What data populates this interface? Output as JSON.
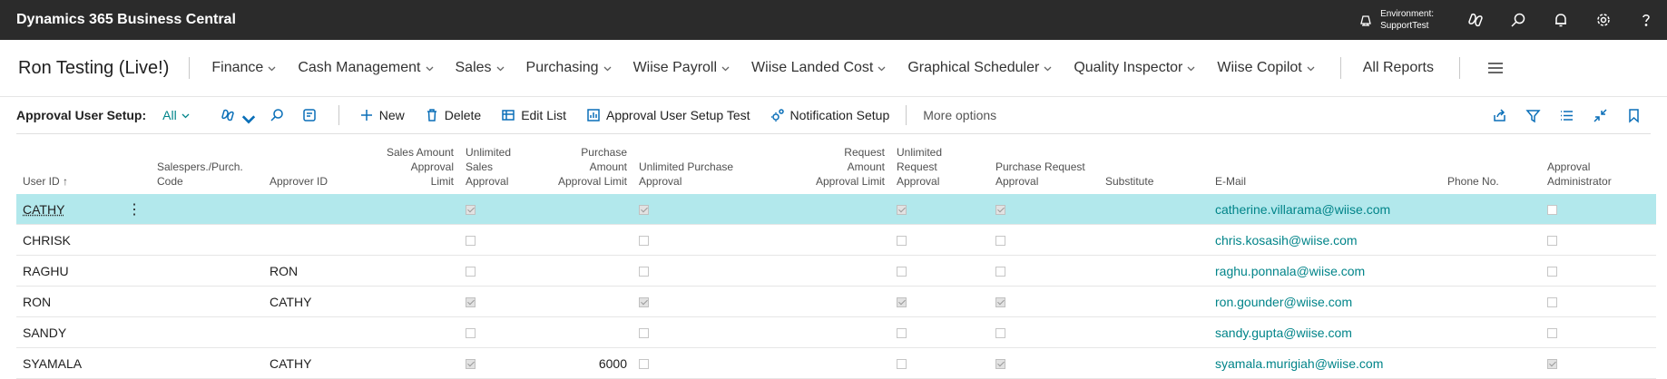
{
  "top_bar": {
    "app_title": "Dynamics 365 Business Central",
    "environment_label": "Environment:",
    "environment_value": "SupportTest",
    "icons": [
      "environment-icon",
      "copilot-icon",
      "search-icon",
      "bell-icon",
      "gear-icon",
      "help-icon"
    ]
  },
  "nav": {
    "company": "Ron Testing (Live!)",
    "items": [
      "Finance",
      "Cash Management",
      "Sales",
      "Purchasing",
      "Wiise Payroll",
      "Wiise Landed Cost",
      "Graphical Scheduler",
      "Quality Inspector",
      "Wiise Copilot"
    ],
    "all_reports": "All Reports"
  },
  "action_bar": {
    "caption": "Approval User Setup:",
    "filter_label": "All",
    "new_label": "New",
    "delete_label": "Delete",
    "edit_list_label": "Edit List",
    "test_label": "Approval User Setup Test",
    "notification_label": "Notification Setup",
    "more_options_label": "More options"
  },
  "table": {
    "headers": {
      "user_id": "User ID",
      "sort_indicator": "↑",
      "salesperson_1": "Salespers./Purch.",
      "salesperson_2": "Code",
      "approver_id": "Approver ID",
      "sales_limit_1": "Sales Amount",
      "sales_limit_2": "Approval",
      "sales_limit_3": "Limit",
      "unl_sales_1": "Unlimited",
      "unl_sales_2": "Sales",
      "unl_sales_3": "Approval",
      "purch_limit_1": "Purchase",
      "purch_limit_2": "Amount",
      "purch_limit_3": "Approval Limit",
      "unl_purch_1": "Unlimited Purchase",
      "unl_purch_2": "Approval",
      "req_limit_1": "Request Amount",
      "req_limit_2": "Approval Limit",
      "unl_req_1": "Unlimited",
      "unl_req_2": "Request",
      "unl_req_3": "Approval",
      "purch_req_1": "Purchase Request",
      "purch_req_2": "Approval",
      "substitute": "Substitute",
      "email": "E-Mail",
      "phone": "Phone No.",
      "admin_1": "Approval",
      "admin_2": "Administrator"
    },
    "rows": [
      {
        "user_id": "CATHY",
        "salesperson": "",
        "approver_id": "",
        "sales_limit": "",
        "unlimited_sales": true,
        "purchase_limit": "",
        "unlimited_purchase": true,
        "request_limit": "",
        "unlimited_request": true,
        "purchase_request": true,
        "substitute": "",
        "email": "catherine.villarama@wiise.com",
        "phone": "",
        "approval_admin": false
      },
      {
        "user_id": "CHRISK",
        "salesperson": "",
        "approver_id": "",
        "sales_limit": "",
        "unlimited_sales": false,
        "purchase_limit": "",
        "unlimited_purchase": false,
        "request_limit": "",
        "unlimited_request": false,
        "purchase_request": false,
        "substitute": "",
        "email": "chris.kosasih@wiise.com",
        "phone": "",
        "approval_admin": false
      },
      {
        "user_id": "RAGHU",
        "salesperson": "",
        "approver_id": "RON",
        "sales_limit": "",
        "unlimited_sales": false,
        "purchase_limit": "",
        "unlimited_purchase": false,
        "request_limit": "",
        "unlimited_request": false,
        "purchase_request": false,
        "substitute": "",
        "email": "raghu.ponnala@wiise.com",
        "phone": "",
        "approval_admin": false
      },
      {
        "user_id": "RON",
        "salesperson": "",
        "approver_id": "CATHY",
        "sales_limit": "",
        "unlimited_sales": true,
        "purchase_limit": "",
        "unlimited_purchase": true,
        "request_limit": "",
        "unlimited_request": true,
        "purchase_request": true,
        "substitute": "",
        "email": "ron.gounder@wiise.com",
        "phone": "",
        "approval_admin": false
      },
      {
        "user_id": "SANDY",
        "salesperson": "",
        "approver_id": "",
        "sales_limit": "",
        "unlimited_sales": false,
        "purchase_limit": "",
        "unlimited_purchase": false,
        "request_limit": "",
        "unlimited_request": false,
        "purchase_request": false,
        "substitute": "",
        "email": "sandy.gupta@wiise.com",
        "phone": "",
        "approval_admin": false
      },
      {
        "user_id": "SYAMALA",
        "salesperson": "",
        "approver_id": "CATHY",
        "sales_limit": "",
        "unlimited_sales": true,
        "purchase_limit": "6000",
        "unlimited_purchase": false,
        "request_limit": "",
        "unlimited_request": false,
        "purchase_request": true,
        "substitute": "",
        "email": "syamala.murigiah@wiise.com",
        "phone": "",
        "approval_admin": true
      }
    ]
  },
  "colors": {
    "top_bar_bg": "#2b2b2b",
    "accent_teal": "#008489",
    "action_blue": "#0a6fb8",
    "selected_row": "#b2e8ec"
  }
}
